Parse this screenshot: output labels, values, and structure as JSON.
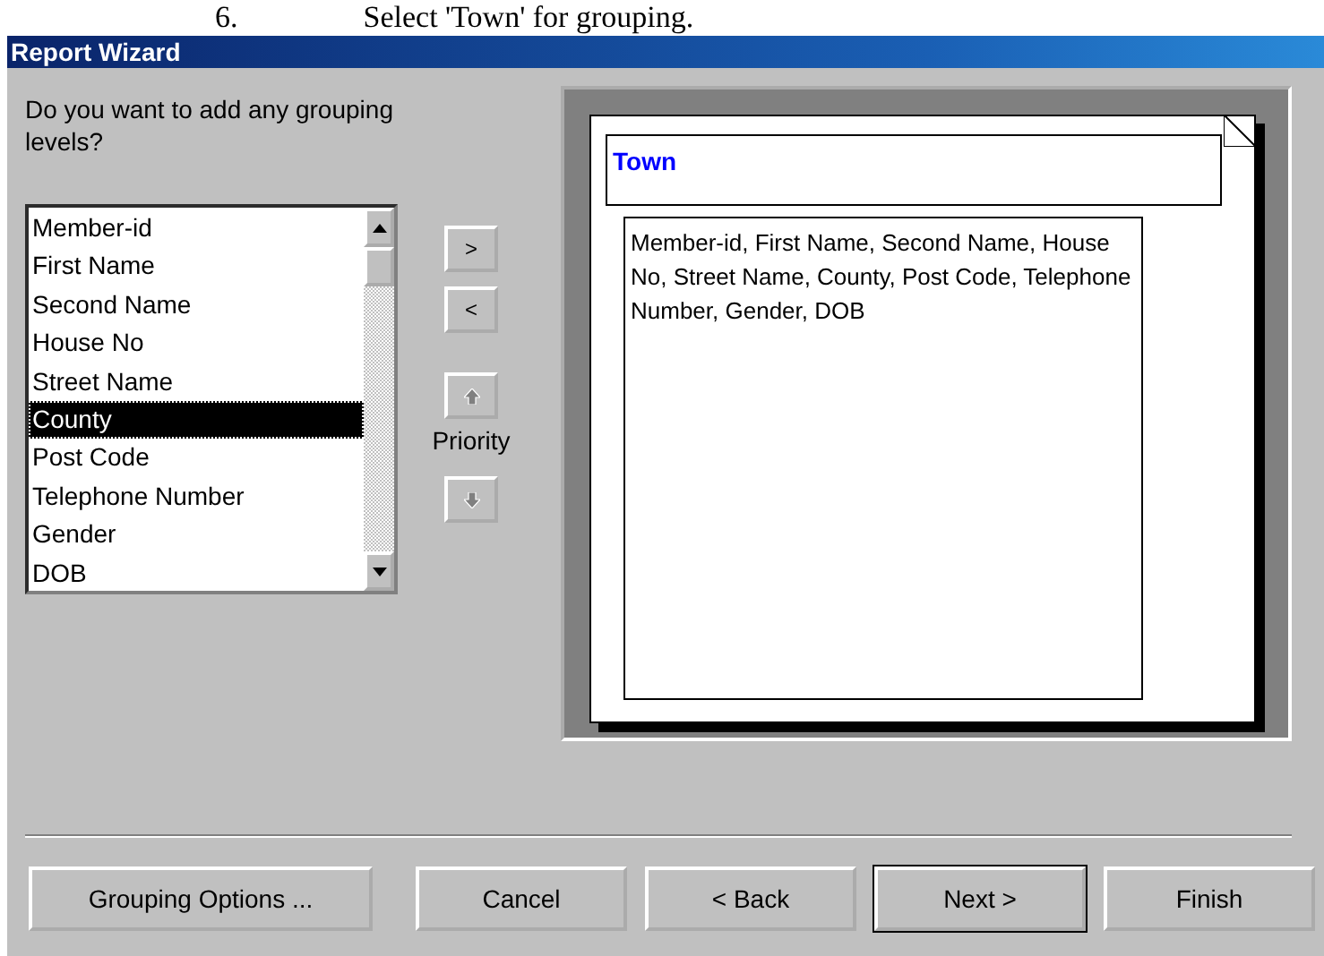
{
  "caption": {
    "number": "6.",
    "text": "Select 'Town' for grouping."
  },
  "window": {
    "title": "Report Wizard"
  },
  "prompt": "Do you want to add any grouping levels?",
  "fields": [
    {
      "label": "Member-id",
      "selected": false
    },
    {
      "label": "First Name",
      "selected": false
    },
    {
      "label": "Second Name",
      "selected": false
    },
    {
      "label": "House No",
      "selected": false
    },
    {
      "label": "Street Name",
      "selected": false
    },
    {
      "label": "County",
      "selected": true
    },
    {
      "label": "Post Code",
      "selected": false
    },
    {
      "label": "Telephone Number",
      "selected": false
    },
    {
      "label": "Gender",
      "selected": false
    },
    {
      "label": "DOB",
      "selected": false
    }
  ],
  "move_buttons": [
    {
      "label": ">",
      "disabled": false
    },
    {
      "label": "<",
      "disabled": false
    }
  ],
  "priority": {
    "label": "Priority",
    "up_disabled": true,
    "down_disabled": true
  },
  "preview": {
    "group_header": "Town",
    "detail": "Member-id, First Name, Second Name, House No, Street Name, County, Post Code, Telephone Number, Gender, DOB"
  },
  "buttons": [
    {
      "label": "Grouping Options ...",
      "default": false
    },
    {
      "label": "Cancel",
      "default": false
    },
    {
      "label": "< Back",
      "default": false
    },
    {
      "label": "Next >",
      "default": true
    },
    {
      "label": "Finish",
      "default": false
    }
  ]
}
